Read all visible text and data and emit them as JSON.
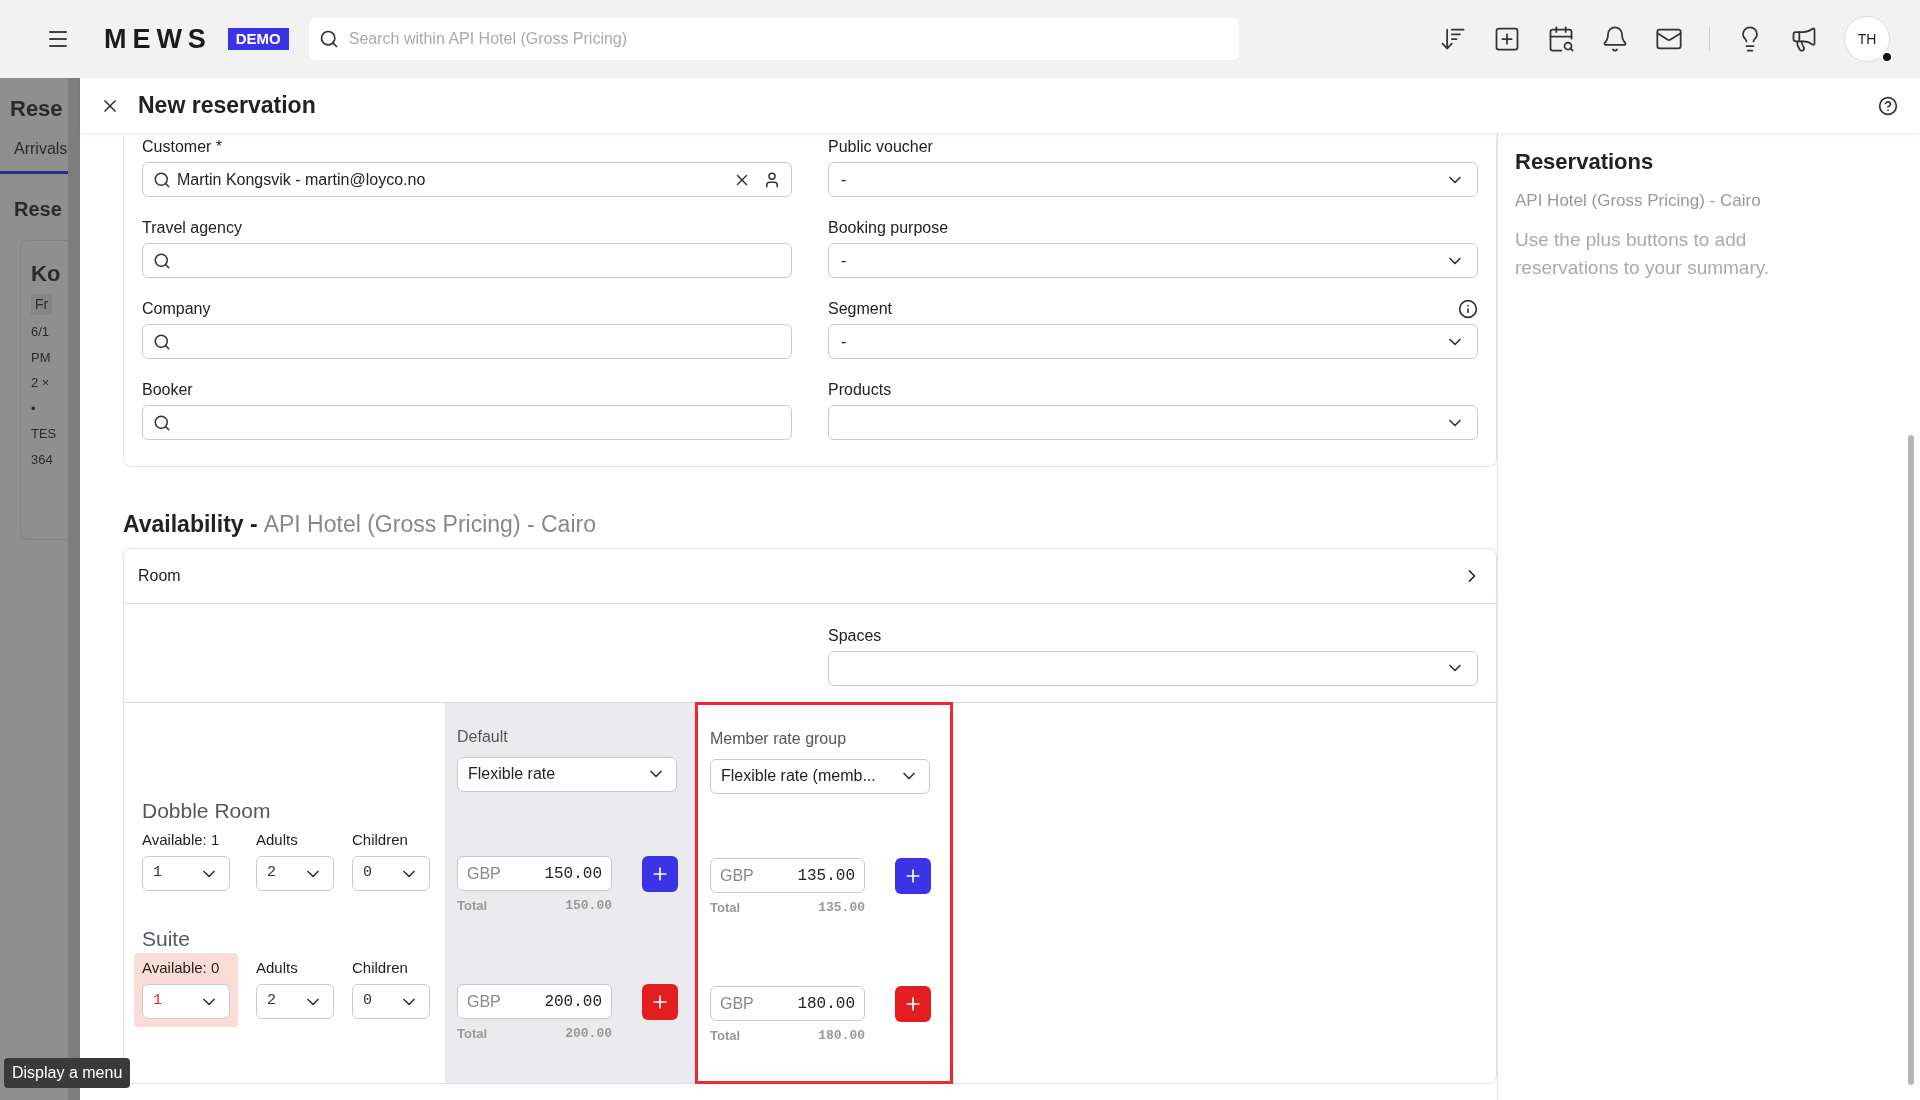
{
  "top_bar": {
    "logo": "MEWS",
    "badge": "DEMO",
    "search": {
      "placeholder": "Search within API Hotel (Gross Pricing)"
    },
    "avatar": "TH"
  },
  "background_page": {
    "title": "Rese",
    "tab": "Arrivals",
    "section": "Rese",
    "card": {
      "title": "Ko",
      "tag": "Fr",
      "lines": [
        "6/1",
        "PM",
        "2 ×",
        "•",
        "TES",
        "364"
      ]
    }
  },
  "modal": {
    "title": "New reservation"
  },
  "form": {
    "left": [
      {
        "label": "Customer *",
        "value": "Martin Kongsvik - martin@loyco.no"
      },
      {
        "label": "Travel agency"
      },
      {
        "label": "Company"
      },
      {
        "label": "Booker"
      }
    ],
    "right": [
      {
        "label": "Public voucher",
        "value": "-"
      },
      {
        "label": "Booking purpose",
        "value": "-"
      },
      {
        "label": "Segment",
        "value": "-",
        "info": true
      },
      {
        "label": "Products"
      }
    ]
  },
  "availability": {
    "title": "Availability -",
    "hotel": "API Hotel (Gross Pricing) - Cairo",
    "room_row": "Room",
    "spaces_label": "Spaces",
    "rate_groups": [
      {
        "name": "Default",
        "rate": "Flexible rate",
        "shaded": true,
        "highlighted": false
      },
      {
        "name": "Member rate group",
        "rate": "Flexible rate (memb...",
        "shaded": false,
        "highlighted": true
      }
    ],
    "rooms": [
      {
        "name": "Dobble Room",
        "available_label": "Available: 1",
        "unavailable": false,
        "count": "1",
        "adults_label": "Adults",
        "adults": "2",
        "children_label": "Children",
        "children": "0",
        "prices": [
          {
            "currency": "GBP",
            "amount": "150.00",
            "total_label": "Total",
            "total": "150.00"
          },
          {
            "currency": "GBP",
            "amount": "135.00",
            "total_label": "Total",
            "total": "135.00"
          }
        ]
      },
      {
        "name": "Suite",
        "available_label": "Available: 0",
        "unavailable": true,
        "count": "1",
        "adults_label": "Adults",
        "adults": "2",
        "children_label": "Children",
        "children": "0",
        "prices": [
          {
            "currency": "GBP",
            "amount": "200.00",
            "total_label": "Total",
            "total": "200.00"
          },
          {
            "currency": "GBP",
            "amount": "180.00",
            "total_label": "Total",
            "total": "180.00"
          }
        ]
      }
    ]
  },
  "summary": {
    "title": "Reservations",
    "hotel": "API Hotel (Gross Pricing) - Cairo",
    "hint": "Use the plus buttons to add reservations to your summary."
  },
  "tooltip": "Display a menu"
}
